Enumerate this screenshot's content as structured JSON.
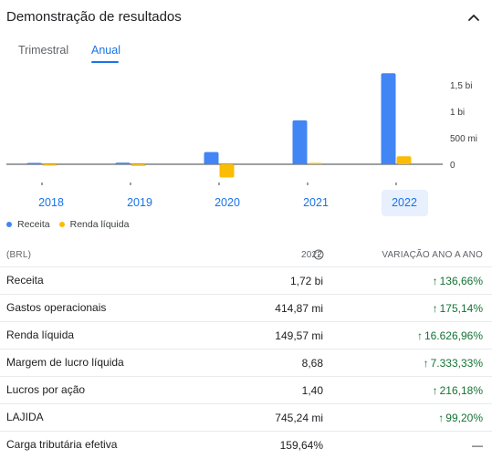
{
  "header": {
    "title": "Demonstração de resultados"
  },
  "tabs": [
    {
      "label": "Trimestral",
      "active": false
    },
    {
      "label": "Anual",
      "active": true
    }
  ],
  "chart_data": {
    "type": "bar",
    "categories": [
      "2018",
      "2019",
      "2020",
      "2021",
      "2022"
    ],
    "selected_category": "2022",
    "series": [
      {
        "name": "Receita",
        "color": "#4285f4",
        "values": [
          0.02,
          0.03,
          0.23,
          0.83,
          1.72
        ]
      },
      {
        "name": "Renda líquida",
        "color": "#fbbc04",
        "values": [
          -0.01,
          -0.03,
          -0.25,
          0.0,
          0.15
        ]
      }
    ],
    "unit": "bi",
    "yticks": [
      {
        "value": 1.5,
        "label": "1,5 bi"
      },
      {
        "value": 1.0,
        "label": "1 bi"
      },
      {
        "value": 0.5,
        "label": "500 mi"
      },
      {
        "value": 0,
        "label": "0"
      }
    ],
    "ylim": [
      -0.3,
      1.8
    ],
    "legend_position": "bottom-left"
  },
  "table": {
    "col_label": "(BRL)",
    "col_year": "2022",
    "col_change": "VARIAÇÃO ANO A ANO",
    "rows": [
      {
        "label": "Receita",
        "value": "1,72 bi",
        "change": "136,66%",
        "dir": "up"
      },
      {
        "label": "Gastos operacionais",
        "value": "414,87 mi",
        "change": "175,14%",
        "dir": "up"
      },
      {
        "label": "Renda líquida",
        "value": "149,57 mi",
        "change": "16.626,96%",
        "dir": "up"
      },
      {
        "label": "Margem de lucro líquida",
        "value": "8,68",
        "change": "7.333,33%",
        "dir": "up"
      },
      {
        "label": "Lucros por ação",
        "value": "1,40",
        "change": "216,18%",
        "dir": "up"
      },
      {
        "label": "LAJIDA",
        "value": "745,24 mi",
        "change": "99,20%",
        "dir": "up"
      },
      {
        "label": "Carga tributária efetiva",
        "value": "159,64%",
        "change": "—",
        "dir": "none"
      }
    ]
  },
  "icons": {
    "collapse": "chevron-up-icon",
    "info": "info-icon",
    "up_arrow": "arrow-up-icon"
  },
  "colors": {
    "accent": "#1a73e8",
    "positive": "#137333",
    "receita": "#4285f4",
    "renda": "#fbbc04"
  }
}
